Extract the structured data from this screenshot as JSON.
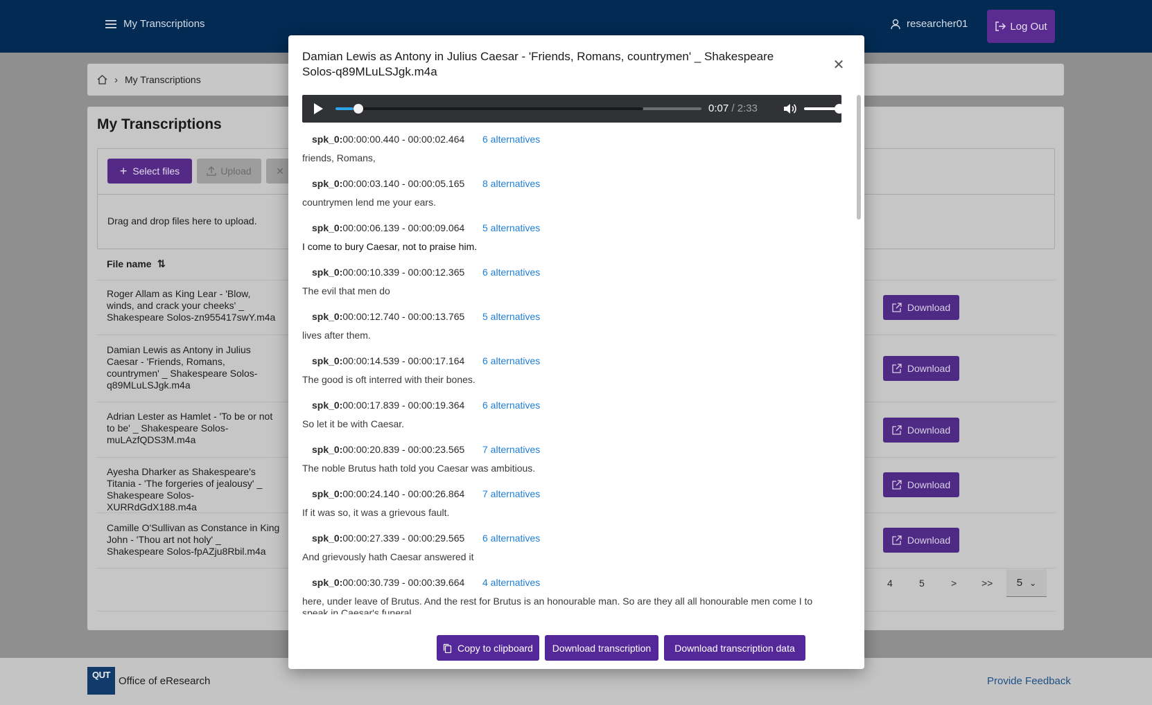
{
  "header": {
    "menu_label": "My Transcriptions",
    "username": "researcher01",
    "logout_label": "Log Out"
  },
  "breadcrumb": {
    "current": "My Transcriptions"
  },
  "page": {
    "title": "My Transcriptions",
    "select_files_label": "Select files",
    "upload_label": "Upload",
    "dropzone_text": "Drag and drop files here to upload.",
    "column_file_name": "File name",
    "download_label": "Download",
    "files": [
      "Roger Allam as King Lear - 'Blow, winds, and crack your cheeks' _ Shakespeare Solos-zn955417swY.m4a",
      "Damian Lewis as Antony in Julius Caesar - 'Friends, Romans, countrymen' _ Shakespeare Solos-q89MLuLSJgk.m4a",
      "Adrian Lester as Hamlet - 'To be or not to be' _ Shakespeare Solos-muLAzfQDS3M.m4a",
      "Ayesha Dharker as Shakespeare's Titania - 'The forgeries of jealousy' _ Shakespeare Solos-XURRdGdX188.m4a",
      "Camille O'Sullivan as Constance in King John - 'Thou art not holy' _ Shakespeare Solos-fpAZju8Rbil.m4a"
    ],
    "pagination": {
      "pages": [
        "4",
        "5"
      ],
      "next": ">",
      "last": ">>",
      "page_size": "5"
    }
  },
  "footer": {
    "logo_text": "QUT",
    "org": "Office of eResearch",
    "feedback": "Provide Feedback"
  },
  "modal": {
    "title": "Damian Lewis as Antony in Julius Caesar - 'Friends, Romans, countrymen' _ Shakespeare Solos-q89MLuLSJgk.m4a",
    "player": {
      "current_time": "0:07",
      "total_time": "/ 2:33",
      "progress_fraction": 0.05,
      "buffered_fraction": 0.84,
      "volume_fraction": 1.0
    },
    "segments": [
      {
        "speaker": "spk_0:",
        "range": "00:00:00.440 - 00:00:02.464",
        "alternatives": "6 alternatives",
        "text": "friends, Romans,"
      },
      {
        "speaker": "spk_0:",
        "range": "00:00:03.140 - 00:00:05.165",
        "alternatives": "8 alternatives",
        "text": "countrymen lend me your ears."
      },
      {
        "speaker": "spk_0:",
        "range": "00:00:06.139 - 00:00:09.064",
        "alternatives": "5 alternatives",
        "text": "I come to bury Caesar, not to praise him."
      },
      {
        "speaker": "spk_0:",
        "range": "00:00:10.339 - 00:00:12.365",
        "alternatives": "6 alternatives",
        "text": "The evil that men do"
      },
      {
        "speaker": "spk_0:",
        "range": "00:00:12.740 - 00:00:13.765",
        "alternatives": "5 alternatives",
        "text": "lives after them."
      },
      {
        "speaker": "spk_0:",
        "range": "00:00:14.539 - 00:00:17.164",
        "alternatives": "6 alternatives",
        "text": "The good is oft interred with their bones."
      },
      {
        "speaker": "spk_0:",
        "range": "00:00:17.839 - 00:00:19.364",
        "alternatives": "6 alternatives",
        "text": "So let it be with Caesar."
      },
      {
        "speaker": "spk_0:",
        "range": "00:00:20.839 - 00:00:23.565",
        "alternatives": "7 alternatives",
        "text": "The noble Brutus hath told you Caesar was ambitious."
      },
      {
        "speaker": "spk_0:",
        "range": "00:00:24.140 - 00:00:26.864",
        "alternatives": "7 alternatives",
        "text": "If it was so, it was a grievous fault."
      },
      {
        "speaker": "spk_0:",
        "range": "00:00:27.339 - 00:00:29.565",
        "alternatives": "6 alternatives",
        "text": "And grievously hath Caesar answered it"
      },
      {
        "speaker": "spk_0:",
        "range": "00:00:30.739 - 00:00:39.664",
        "alternatives": "4 alternatives",
        "text": "here, under leave of Brutus. And the rest for Brutus is an honourable man. So are they all all honourable men come I to speak in Caesar's funeral."
      }
    ],
    "buttons": {
      "copy": "Copy to clipboard",
      "download": "Download transcription",
      "download_data": "Download transcription data"
    }
  },
  "colors": {
    "topbar": "#022a52",
    "primary": "#55289a",
    "link": "#1d7fd6",
    "player_progress": "#2ea3e8"
  }
}
